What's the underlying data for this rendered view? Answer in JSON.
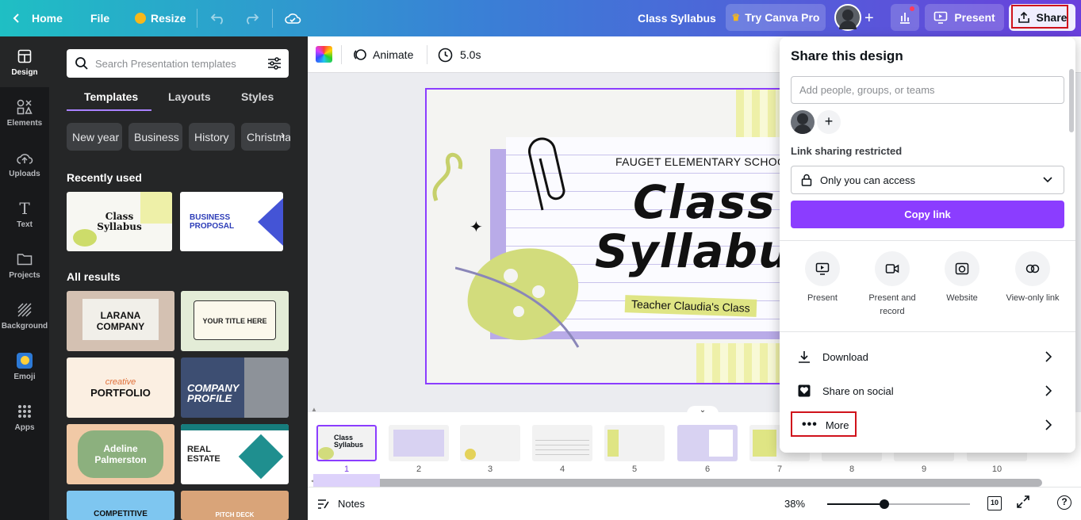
{
  "topbar": {
    "home": "Home",
    "file": "File",
    "resize": "Resize",
    "doc_title": "Class Syllabus",
    "try_pro": "Try Canva Pro",
    "present": "Present",
    "share": "Share"
  },
  "rail": {
    "items": [
      {
        "label": "Design",
        "icon": "design-icon"
      },
      {
        "label": "Elements",
        "icon": "elements-icon"
      },
      {
        "label": "Uploads",
        "icon": "upload-icon"
      },
      {
        "label": "Text",
        "icon": "text-icon"
      },
      {
        "label": "Projects",
        "icon": "folder-icon"
      },
      {
        "label": "Background",
        "icon": "background-icon"
      },
      {
        "label": "Emoji",
        "icon": "emoji-icon"
      },
      {
        "label": "Apps",
        "icon": "apps-icon"
      }
    ]
  },
  "panel": {
    "search_placeholder": "Search Presentation templates",
    "tabs": [
      "Templates",
      "Layouts",
      "Styles"
    ],
    "chips": [
      "New year",
      "Business",
      "History",
      "Christmas"
    ],
    "recently_used": "Recently used",
    "all_results": "All results",
    "recent": [
      {
        "line1": "Class",
        "line2": "Syllabus"
      },
      {
        "line1": "BUSINESS",
        "line2": "PROPOSAL"
      }
    ],
    "results": [
      {
        "line1": "LARANA",
        "line2": "COMPANY"
      },
      {
        "line1": "YOUR TITLE HERE",
        "line2": ""
      },
      {
        "line1": "creative",
        "line2": "PORTFOLIO"
      },
      {
        "line1": "COMPANY",
        "line2": "PROFILE"
      },
      {
        "line1": "Adeline",
        "line2": "Palmerston"
      },
      {
        "line1": "REAL",
        "line2": "ESTATE"
      },
      {
        "line1": "COMPETITIVE",
        "line2": ""
      },
      {
        "line1": "PITCH DECK",
        "line2": ""
      }
    ]
  },
  "toolbar": {
    "animate": "Animate",
    "duration": "5.0s"
  },
  "slide": {
    "school": "FAUGET ELEMENTARY SCHOOL",
    "title1": "Class",
    "title2": "Syllabus",
    "teacher": "Teacher Claudia's Class"
  },
  "pages": [
    "1",
    "2",
    "3",
    "4",
    "5",
    "6",
    "7",
    "8",
    "9",
    "10"
  ],
  "bottom": {
    "notes": "Notes",
    "zoom": "38%",
    "zoom_fraction": 0.4,
    "page_count": "10"
  },
  "share": {
    "title": "Share this design",
    "add_placeholder": "Add people, groups, or teams",
    "link_label": "Link sharing restricted",
    "access": "Only you can access",
    "copy_link": "Copy link",
    "options": [
      {
        "label": "Present",
        "icon": "present-icon"
      },
      {
        "label": "Present and record",
        "icon": "record-icon"
      },
      {
        "label": "Website",
        "icon": "website-icon"
      },
      {
        "label": "View-only link",
        "icon": "link-icon"
      }
    ],
    "download": "Download",
    "social": "Share on social",
    "more": "More"
  },
  "colors": {
    "accent": "#8b3dff",
    "highlight": "#d0121b"
  }
}
